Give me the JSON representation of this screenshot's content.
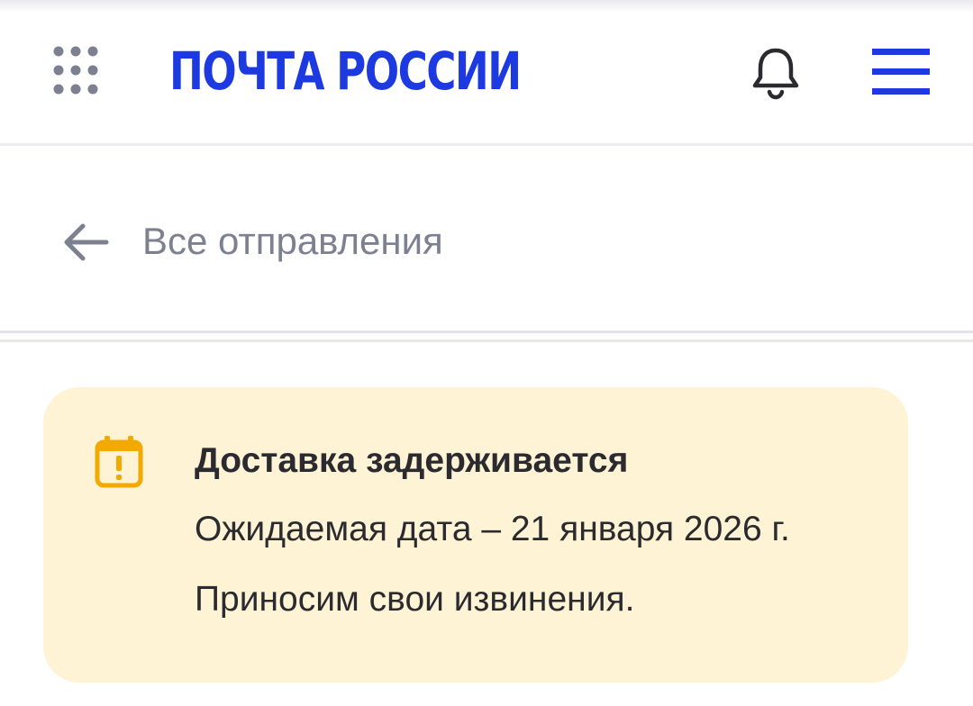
{
  "header": {
    "logo_text": "ПОЧТА РОССИИ",
    "apps_icon": "apps-grid-icon",
    "bell_icon": "bell-icon",
    "menu_icon": "hamburger-menu-icon",
    "brand_color": "#1c3ae0"
  },
  "nav": {
    "back_label": "Все отправления",
    "back_icon": "arrow-left-icon"
  },
  "notice": {
    "icon": "calendar-alert-icon",
    "title": "Доставка задерживается",
    "expected_date": "Ожидаемая дата – 21 января 2026 г.",
    "apology": "Приносим свои извинения.",
    "background_color": "#fff3d6",
    "icon_color": "#f2a900"
  }
}
